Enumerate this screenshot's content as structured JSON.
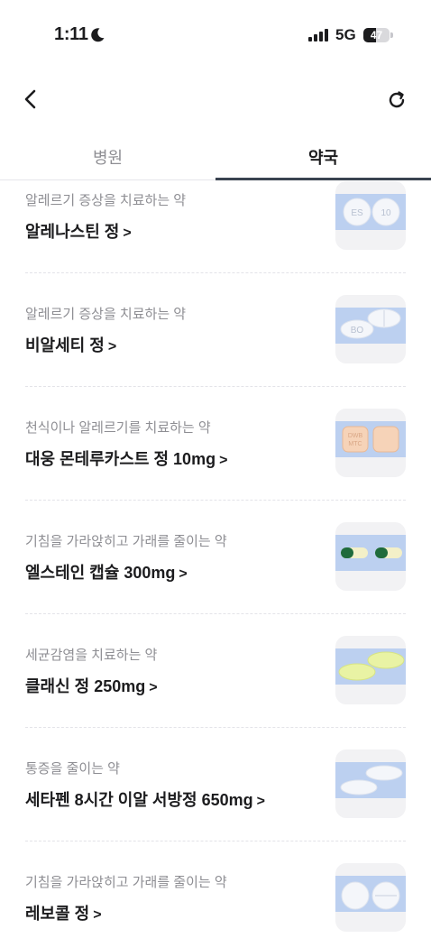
{
  "status": {
    "time": "1:11",
    "network": "5G",
    "battery": "47",
    "battery_level": 0.47
  },
  "nav": {
    "back_icon": "chevron-left-icon",
    "refresh_icon": "refresh-icon"
  },
  "tabs": [
    {
      "label": "병원",
      "active": false
    },
    {
      "label": "약국",
      "active": true
    }
  ],
  "items": [
    {
      "desc": "알레르기 증상을 치료하는 약",
      "name": "알레나스틴 정",
      "pill_marks": [
        "ES",
        "10"
      ]
    },
    {
      "desc": "알레르기 증상을 치료하는 약",
      "name": "비알세티 정",
      "pill_marks": [
        "BO"
      ]
    },
    {
      "desc": "천식이나 알레르기를 치료하는 약",
      "name": "대웅 몬테루카스트 정 10mg",
      "pill_marks": [
        "DWB",
        "MTC"
      ]
    },
    {
      "desc": "기침을 가라앉히고 가래를 줄이는 약",
      "name": "엘스테인 캡슐 300mg",
      "pill_marks": []
    },
    {
      "desc": "세균감염을 치료하는 약",
      "name": "클래신 정 250mg",
      "pill_marks": []
    },
    {
      "desc": "통증을 줄이는 약",
      "name": "세타펜 8시간 이알 서방정 650mg",
      "pill_marks": []
    },
    {
      "desc": "기침을 가라앉히고 가래를 줄이는 약",
      "name": "레보콜 정",
      "pill_marks": []
    }
  ],
  "chevron": ">"
}
